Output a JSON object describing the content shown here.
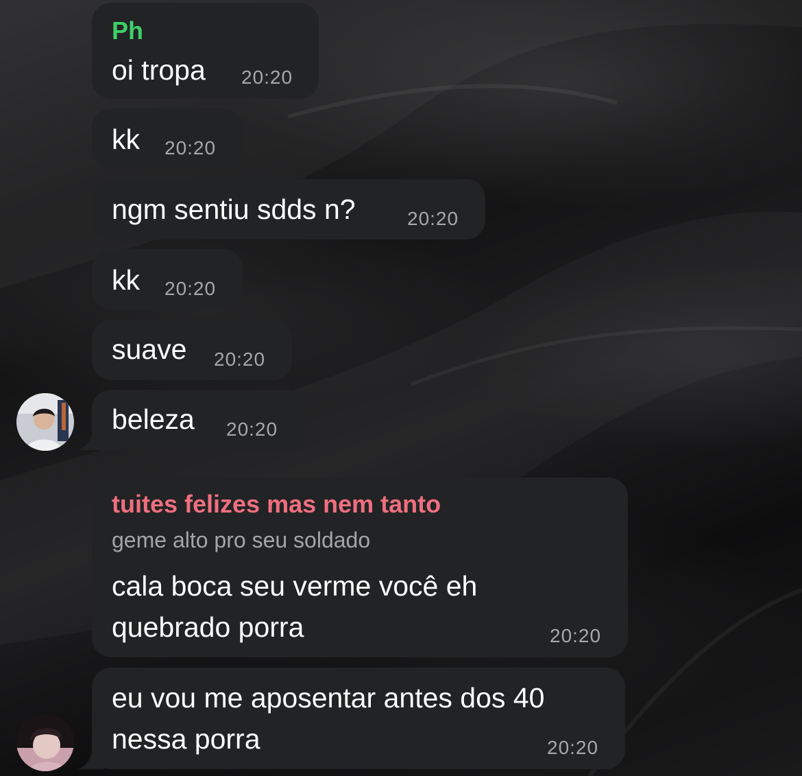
{
  "colors": {
    "bubble": "#222324",
    "sender_ph": "#3fcf6a",
    "sender_reply": "#ef6f80",
    "time": "#a8a8aa",
    "reply_text": "#a5a5a7"
  },
  "messages": [
    {
      "sender": "Ph",
      "text": "oi tropa",
      "time": "20:20"
    },
    {
      "text": "kk",
      "time": "20:20"
    },
    {
      "text": "ngm sentiu sdds n?",
      "time": "20:20"
    },
    {
      "text": "kk",
      "time": "20:20"
    },
    {
      "text": "suave",
      "time": "20:20"
    },
    {
      "text": "beleza",
      "time": "20:20",
      "avatar": "user-avatar-photo"
    },
    {
      "reply_to": {
        "sender": "tuites felizes mas nem tanto",
        "text": "geme alto pro seu soldado"
      },
      "lines": [
        "cala boca seu verme você eh",
        "quebrado porra"
      ],
      "time": "20:20"
    },
    {
      "lines": [
        "eu vou me aposentar antes dos 40",
        "nessa porra"
      ],
      "time": "20:20",
      "avatar": "user-avatar-photo"
    }
  ]
}
